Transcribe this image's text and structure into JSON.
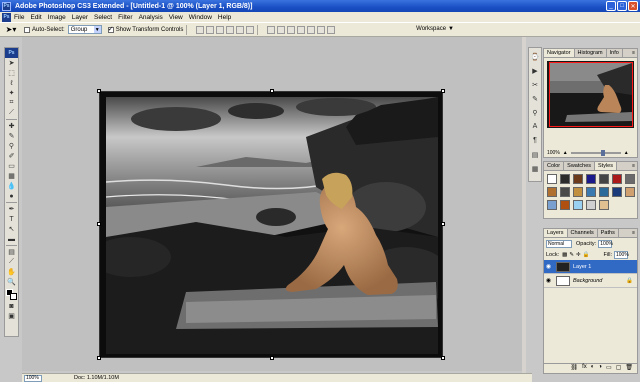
{
  "window": {
    "title": "Adobe Photoshop CS3 Extended - [Untitled-1 @ 100% (Layer 1, RGB/8)]",
    "app_badge": "Ps"
  },
  "menu": [
    "File",
    "Edit",
    "Image",
    "Layer",
    "Select",
    "Filter",
    "Analysis",
    "View",
    "Window",
    "Help"
  ],
  "options": {
    "auto_select_label": "Auto-Select:",
    "auto_select_value": "Group",
    "show_transform_label": "Show Transform Controls",
    "workspace_label": "Workspace"
  },
  "status": {
    "zoom": "100%",
    "doc": "Doc: 1.10M/1.10M"
  },
  "navigator": {
    "tabs": [
      "Navigator",
      "Histogram",
      "Info"
    ],
    "zoom": "100%"
  },
  "styles_panel": {
    "tabs": [
      "Color",
      "Swatches",
      "Styles"
    ],
    "swatch_colors": [
      "#ffffff",
      "#2b2b2b",
      "#6a3a1a",
      "#1a1a8a",
      "#444444",
      "#aa1a1a",
      "#6a6a6a",
      "#b07030",
      "#4a4a4a",
      "#c09040",
      "#3a7ab0",
      "#2a6a9a",
      "#1a3a7a",
      "#d0a070",
      "#7aa0d0",
      "#b05010",
      "#9ad0f0",
      "#d0d0d0",
      "#e0c090"
    ]
  },
  "layers": {
    "tabs": [
      "Layers",
      "Channels",
      "Paths"
    ],
    "blend_mode": "Normal",
    "opacity_label": "Opacity:",
    "opacity": "100%",
    "lock_label": "Lock:",
    "fill_label": "Fill:",
    "fill": "100%",
    "items": [
      {
        "name": "Layer 1",
        "active": true
      },
      {
        "name": "Background",
        "active": false
      }
    ]
  },
  "colors": {
    "accent": "#316ac5",
    "titlebar": "#1a4fc4",
    "nav_rect": "#ff1a1a"
  }
}
